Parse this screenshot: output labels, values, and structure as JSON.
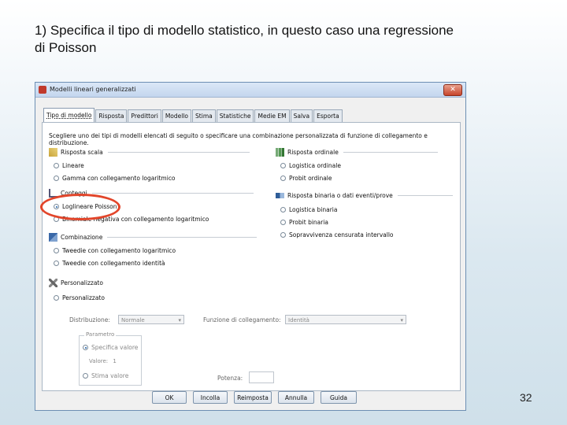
{
  "slide": {
    "title_line1": "1) Specifica il tipo di modello statistico, in questo caso una regressione",
    "title_line2": "di Poisson",
    "page_number": "32"
  },
  "dialog": {
    "title": "Modelli lineari generalizzati",
    "close_label": "✕",
    "tabs": [
      {
        "label": "Tipo di modello",
        "active": true
      },
      {
        "label": "Risposta"
      },
      {
        "label": "Predittori"
      },
      {
        "label": "Modello"
      },
      {
        "label": "Stima"
      },
      {
        "label": "Statistiche"
      },
      {
        "label": "Medie EM"
      },
      {
        "label": "Salva"
      },
      {
        "label": "Esporta"
      }
    ],
    "intro": "Scegliere uno dei tipi di modelli elencati di seguito o specificare una combinazione personalizzata di funzione di collegamento e distribuzione.",
    "left_sections": {
      "scala": {
        "title": "Risposta scala",
        "options": [
          "Lineare",
          "Gamma con collegamento logaritmico"
        ]
      },
      "conteggi": {
        "title": "Conteggi",
        "options": [
          "Loglineare Poisson",
          "Binomiale negativa con collegamento logaritmico"
        ],
        "selected": 0
      },
      "combinazione": {
        "title": "Combinazione",
        "options": [
          "Tweedie con collegamento logaritmico",
          "Tweedie con collegamento identità"
        ]
      },
      "personalizzato": {
        "title": "Personalizzato",
        "options": [
          "Personalizzato"
        ]
      }
    },
    "right_sections": {
      "ordinale": {
        "title": "Risposta ordinale",
        "options": [
          "Logistica ordinale",
          "Probit ordinale"
        ]
      },
      "binaria": {
        "title": "Risposta binaria o dati eventi/prove",
        "options": [
          "Logistica binaria",
          "Probit binaria",
          "Sopravvivenza censurata intervallo"
        ]
      }
    },
    "custom": {
      "distribuzione_label": "Distribuzione:",
      "distribuzione_value": "Normale",
      "funzione_label": "Funzione di collegamento:",
      "funzione_value": "Identità",
      "parametro_legend": "Parametro",
      "specifica_valore": "Specifica valore",
      "valore_label": "Valore:",
      "valore_value": "1",
      "stima_valore": "Stima valore",
      "potenza_label": "Potenza:"
    },
    "buttons": [
      "OK",
      "Incolla",
      "Reimposta",
      "Annulla",
      "Guida"
    ]
  },
  "colors": {
    "highlight": "#e2452a",
    "title_bar": "#c3d6ee"
  }
}
